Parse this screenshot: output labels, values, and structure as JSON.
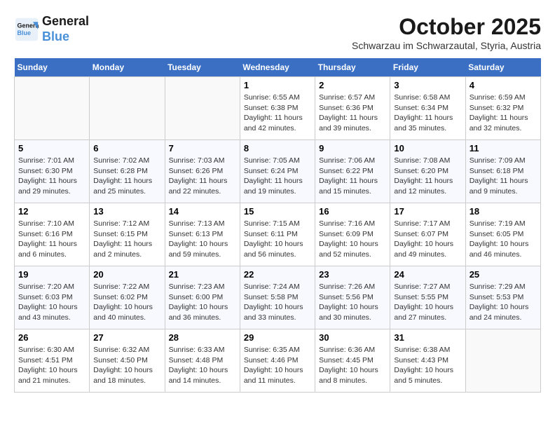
{
  "header": {
    "logo_line1": "General",
    "logo_line2": "Blue",
    "month": "October 2025",
    "subtitle": "Schwarzau im Schwarzautal, Styria, Austria"
  },
  "weekdays": [
    "Sunday",
    "Monday",
    "Tuesday",
    "Wednesday",
    "Thursday",
    "Friday",
    "Saturday"
  ],
  "weeks": [
    [
      {
        "day": "",
        "sunrise": "",
        "sunset": "",
        "daylight": ""
      },
      {
        "day": "",
        "sunrise": "",
        "sunset": "",
        "daylight": ""
      },
      {
        "day": "",
        "sunrise": "",
        "sunset": "",
        "daylight": ""
      },
      {
        "day": "1",
        "sunrise": "6:55 AM",
        "sunset": "6:38 PM",
        "daylight": "11 hours and 42 minutes."
      },
      {
        "day": "2",
        "sunrise": "6:57 AM",
        "sunset": "6:36 PM",
        "daylight": "11 hours and 39 minutes."
      },
      {
        "day": "3",
        "sunrise": "6:58 AM",
        "sunset": "6:34 PM",
        "daylight": "11 hours and 35 minutes."
      },
      {
        "day": "4",
        "sunrise": "6:59 AM",
        "sunset": "6:32 PM",
        "daylight": "11 hours and 32 minutes."
      }
    ],
    [
      {
        "day": "5",
        "sunrise": "7:01 AM",
        "sunset": "6:30 PM",
        "daylight": "11 hours and 29 minutes."
      },
      {
        "day": "6",
        "sunrise": "7:02 AM",
        "sunset": "6:28 PM",
        "daylight": "11 hours and 25 minutes."
      },
      {
        "day": "7",
        "sunrise": "7:03 AM",
        "sunset": "6:26 PM",
        "daylight": "11 hours and 22 minutes."
      },
      {
        "day": "8",
        "sunrise": "7:05 AM",
        "sunset": "6:24 PM",
        "daylight": "11 hours and 19 minutes."
      },
      {
        "day": "9",
        "sunrise": "7:06 AM",
        "sunset": "6:22 PM",
        "daylight": "11 hours and 15 minutes."
      },
      {
        "day": "10",
        "sunrise": "7:08 AM",
        "sunset": "6:20 PM",
        "daylight": "11 hours and 12 minutes."
      },
      {
        "day": "11",
        "sunrise": "7:09 AM",
        "sunset": "6:18 PM",
        "daylight": "11 hours and 9 minutes."
      }
    ],
    [
      {
        "day": "12",
        "sunrise": "7:10 AM",
        "sunset": "6:16 PM",
        "daylight": "11 hours and 6 minutes."
      },
      {
        "day": "13",
        "sunrise": "7:12 AM",
        "sunset": "6:15 PM",
        "daylight": "11 hours and 2 minutes."
      },
      {
        "day": "14",
        "sunrise": "7:13 AM",
        "sunset": "6:13 PM",
        "daylight": "10 hours and 59 minutes."
      },
      {
        "day": "15",
        "sunrise": "7:15 AM",
        "sunset": "6:11 PM",
        "daylight": "10 hours and 56 minutes."
      },
      {
        "day": "16",
        "sunrise": "7:16 AM",
        "sunset": "6:09 PM",
        "daylight": "10 hours and 52 minutes."
      },
      {
        "day": "17",
        "sunrise": "7:17 AM",
        "sunset": "6:07 PM",
        "daylight": "10 hours and 49 minutes."
      },
      {
        "day": "18",
        "sunrise": "7:19 AM",
        "sunset": "6:05 PM",
        "daylight": "10 hours and 46 minutes."
      }
    ],
    [
      {
        "day": "19",
        "sunrise": "7:20 AM",
        "sunset": "6:03 PM",
        "daylight": "10 hours and 43 minutes."
      },
      {
        "day": "20",
        "sunrise": "7:22 AM",
        "sunset": "6:02 PM",
        "daylight": "10 hours and 40 minutes."
      },
      {
        "day": "21",
        "sunrise": "7:23 AM",
        "sunset": "6:00 PM",
        "daylight": "10 hours and 36 minutes."
      },
      {
        "day": "22",
        "sunrise": "7:24 AM",
        "sunset": "5:58 PM",
        "daylight": "10 hours and 33 minutes."
      },
      {
        "day": "23",
        "sunrise": "7:26 AM",
        "sunset": "5:56 PM",
        "daylight": "10 hours and 30 minutes."
      },
      {
        "day": "24",
        "sunrise": "7:27 AM",
        "sunset": "5:55 PM",
        "daylight": "10 hours and 27 minutes."
      },
      {
        "day": "25",
        "sunrise": "7:29 AM",
        "sunset": "5:53 PM",
        "daylight": "10 hours and 24 minutes."
      }
    ],
    [
      {
        "day": "26",
        "sunrise": "6:30 AM",
        "sunset": "4:51 PM",
        "daylight": "10 hours and 21 minutes."
      },
      {
        "day": "27",
        "sunrise": "6:32 AM",
        "sunset": "4:50 PM",
        "daylight": "10 hours and 18 minutes."
      },
      {
        "day": "28",
        "sunrise": "6:33 AM",
        "sunset": "4:48 PM",
        "daylight": "10 hours and 14 minutes."
      },
      {
        "day": "29",
        "sunrise": "6:35 AM",
        "sunset": "4:46 PM",
        "daylight": "10 hours and 11 minutes."
      },
      {
        "day": "30",
        "sunrise": "6:36 AM",
        "sunset": "4:45 PM",
        "daylight": "10 hours and 8 minutes."
      },
      {
        "day": "31",
        "sunrise": "6:38 AM",
        "sunset": "4:43 PM",
        "daylight": "10 hours and 5 minutes."
      },
      {
        "day": "",
        "sunrise": "",
        "sunset": "",
        "daylight": ""
      }
    ]
  ]
}
